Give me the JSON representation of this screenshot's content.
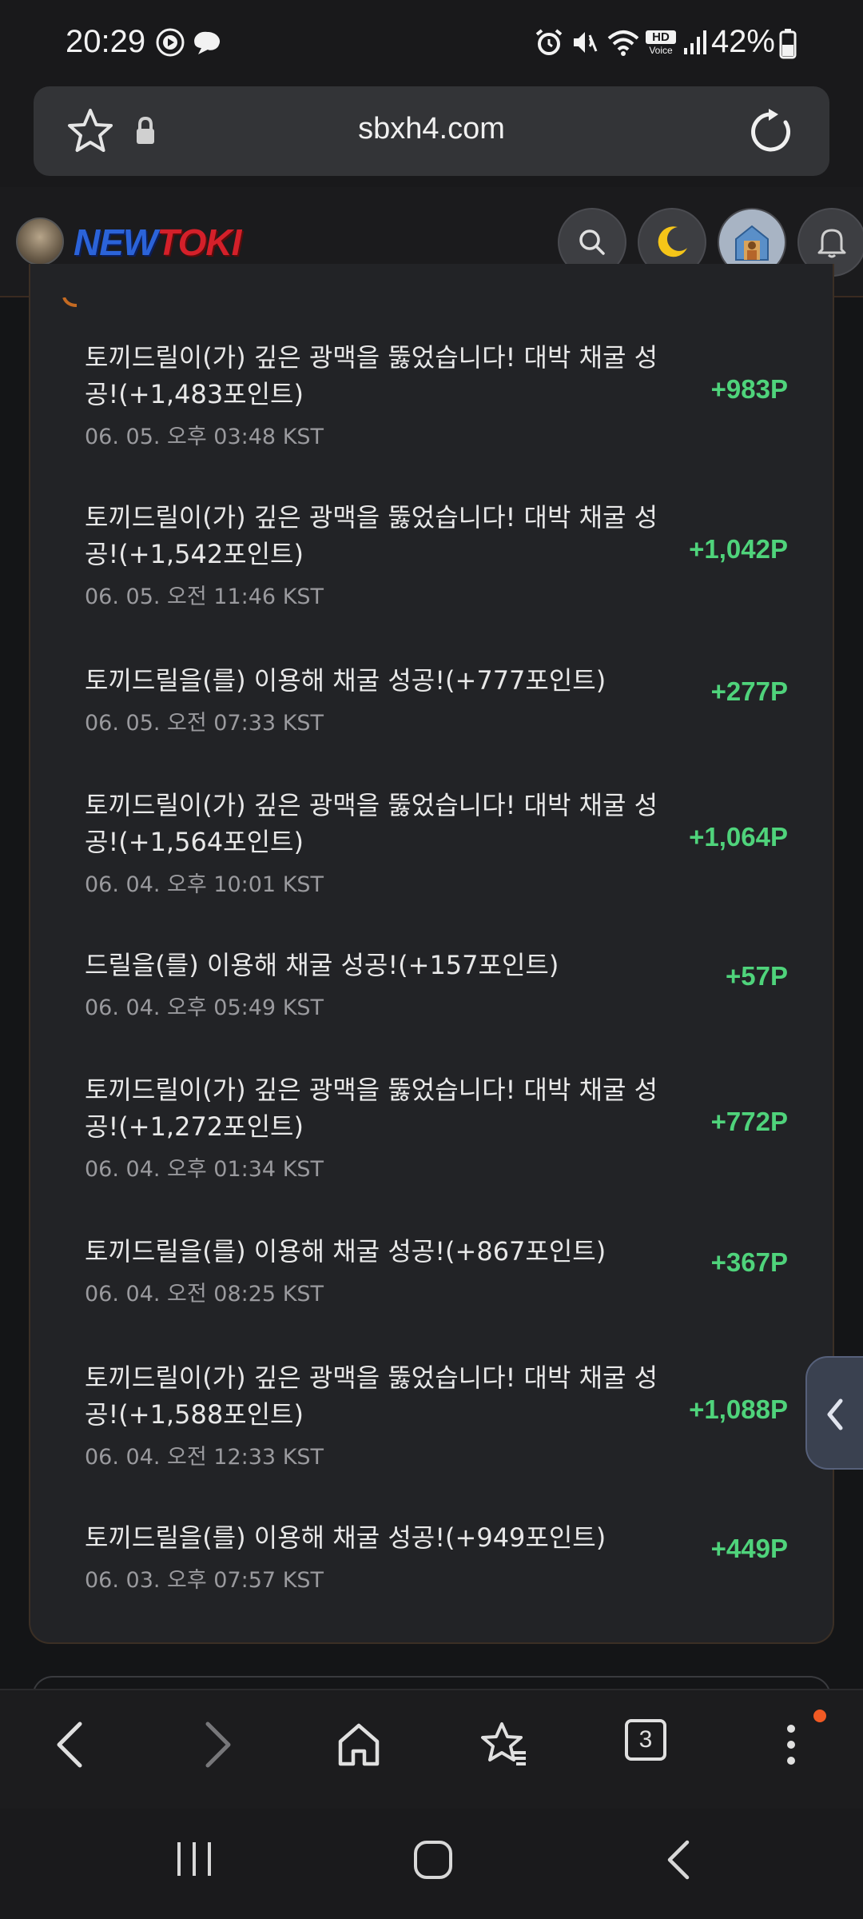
{
  "status_bar": {
    "time": "20:29",
    "battery_percent": "42%",
    "icons": [
      "media-play-icon",
      "messenger-icon",
      "alarm-icon",
      "mute-icon",
      "wifi-icon",
      "hd-voice-icon",
      "signal-icon",
      "battery-icon"
    ],
    "hd_label": "HD",
    "voice_label": "Voice"
  },
  "browser": {
    "url": "sbxh4.com",
    "tab_count": "3"
  },
  "site": {
    "logo_new": "NEW",
    "logo_toki": "TOKI"
  },
  "history": [
    {
      "text": "토끼드릴이(가) 깊은 광맥을 뚫었습니다! 대박 채굴 성공!(+1,483포인트)",
      "date": "06. 05. 오후 03:48 KST",
      "points": "+983P"
    },
    {
      "text": "토끼드릴이(가) 깊은 광맥을 뚫었습니다! 대박 채굴 성공!(+1,542포인트)",
      "date": "06. 05. 오전 11:46 KST",
      "points": "+1,042P"
    },
    {
      "text": "토끼드릴을(를) 이용해 채굴 성공!(+777포인트)",
      "date": "06. 05. 오전 07:33 KST",
      "points": "+277P"
    },
    {
      "text": "토끼드릴이(가) 깊은 광맥을 뚫었습니다! 대박 채굴 성공!(+1,564포인트)",
      "date": "06. 04. 오후 10:01 KST",
      "points": "+1,064P"
    },
    {
      "text": "드릴을(를) 이용해 채굴 성공!(+157포인트)",
      "date": "06. 04. 오후 05:49 KST",
      "points": "+57P"
    },
    {
      "text": "토끼드릴이(가) 깊은 광맥을 뚫었습니다! 대박 채굴 성공!(+1,272포인트)",
      "date": "06. 04. 오후 01:34 KST",
      "points": "+772P"
    },
    {
      "text": "토끼드릴을(를) 이용해 채굴 성공!(+867포인트)",
      "date": "06. 04. 오전 08:25 KST",
      "points": "+367P"
    },
    {
      "text": "토끼드릴이(가) 깊은 광맥을 뚫었습니다! 대박 채굴 성공!(+1,588포인트)",
      "date": "06. 04. 오전 12:33 KST",
      "points": "+1,088P"
    },
    {
      "text": "토끼드릴을(를) 이용해 채굴 성공!(+949포인트)",
      "date": "06. 03. 오후 07:57 KST",
      "points": "+449P"
    }
  ],
  "colors": {
    "points_green": "#4fd37b",
    "accent_orange": "#f15a24",
    "logo_blue": "#2b63d9",
    "logo_red": "#d4202a"
  }
}
